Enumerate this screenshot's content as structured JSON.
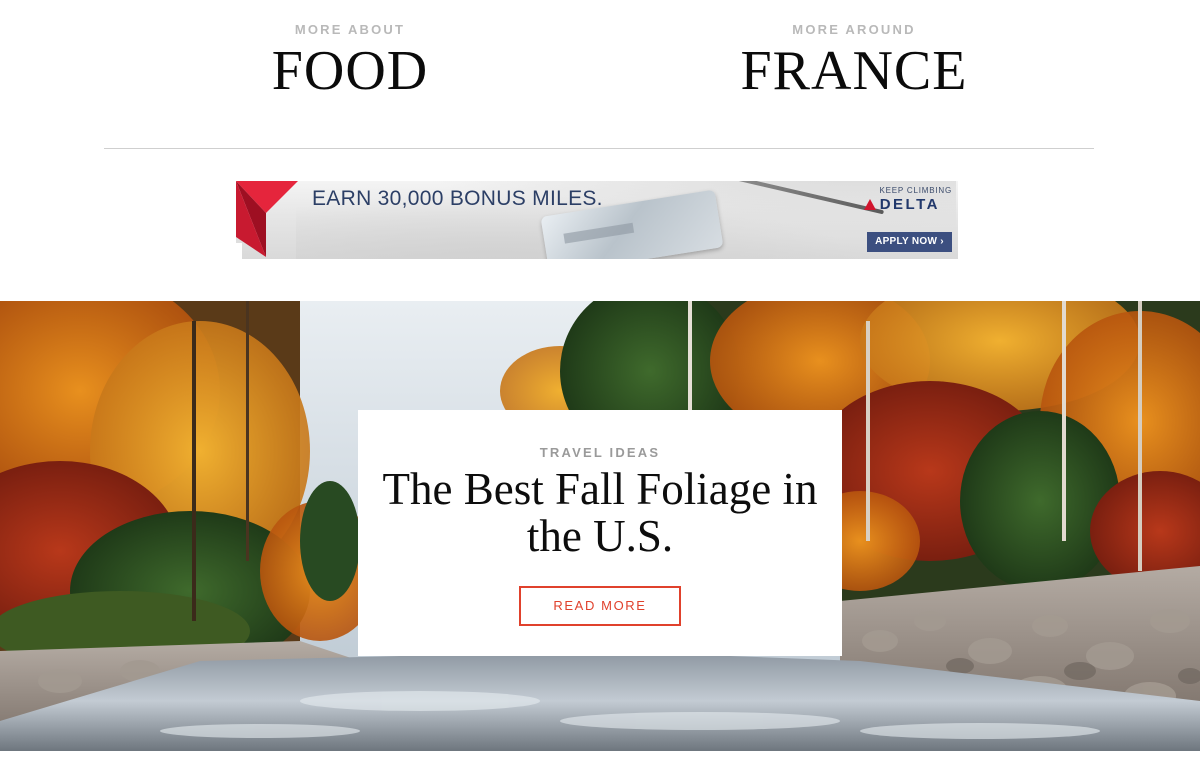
{
  "more_about": {
    "eyebrow": "MORE ABOUT",
    "title": "FOOD"
  },
  "more_around": {
    "eyebrow": "MORE AROUND",
    "title": "FRANCE"
  },
  "ad": {
    "headline": "EARN 30,000 BONUS MILES.",
    "tagline": "KEEP CLIMBING",
    "brand": "DELTA",
    "cta": "APPLY NOW ›",
    "colors": {
      "brand_red": "#d1152d",
      "navy": "#2c3f66",
      "button": "#3c4f80"
    }
  },
  "feature": {
    "eyebrow": "TRAVEL IDEAS",
    "title": "The Best Fall Foliage in the U.S.",
    "cta": "READ MORE",
    "image": "autumn river with fall foliage",
    "colors": {
      "accent": "#e0412c"
    }
  }
}
